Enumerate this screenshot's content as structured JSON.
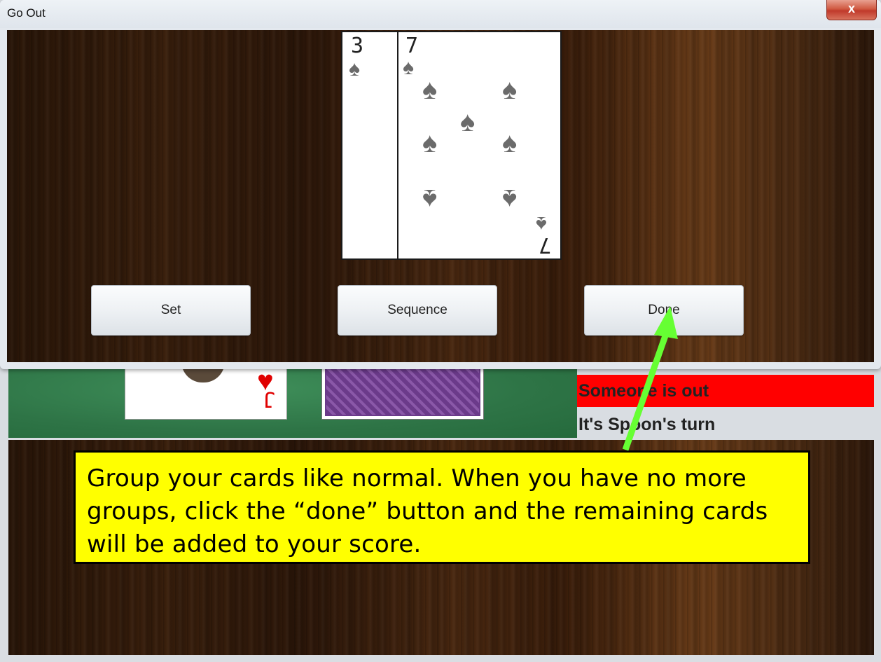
{
  "window": {
    "title": "Go Out",
    "close_label": "x"
  },
  "dialog": {
    "cards": [
      {
        "rank": "3",
        "suit": "spades"
      },
      {
        "rank": "7",
        "suit": "spades"
      }
    ],
    "buttons": {
      "set": "Set",
      "sequence": "Sequence",
      "done": "Done"
    }
  },
  "game": {
    "status": {
      "out_message": "Someone is out",
      "turn_message": "It's Spoon's turn"
    },
    "visible_card_rank": "J",
    "colors": {
      "out_bg": "#ff0000",
      "felt": "#2e7446",
      "card_back": "#6b3a8a"
    }
  },
  "annotation": {
    "text": "Group your cards like normal. When you have no more groups, click the “done” button and the remaining cards will be added to your score.",
    "arrow_color": "#66ff33",
    "background": "#ffff00"
  }
}
